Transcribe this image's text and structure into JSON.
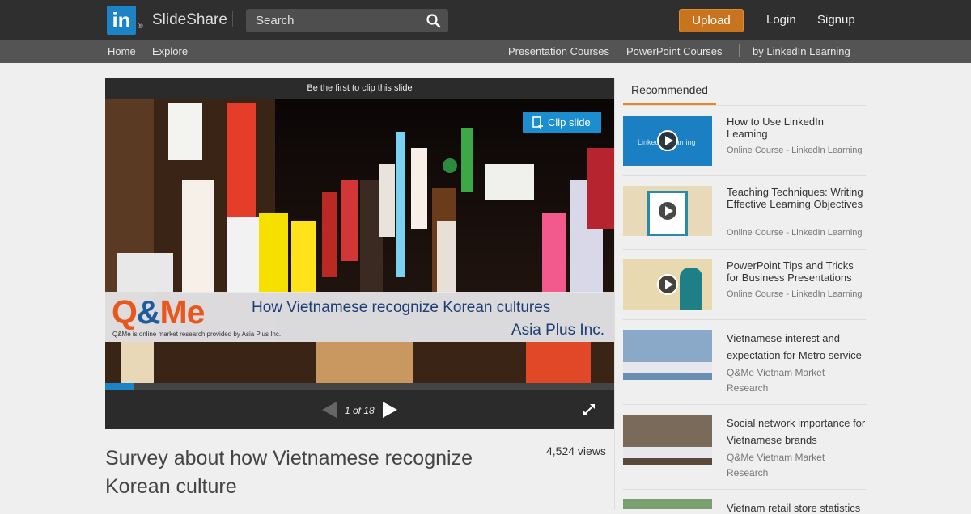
{
  "header": {
    "logo_text": "in",
    "logo_reg": "®",
    "brand": "SlideShare",
    "search_placeholder": "Search",
    "upload_label": "Upload",
    "login_label": "Login",
    "signup_label": "Signup"
  },
  "subnav": {
    "home": "Home",
    "explore": "Explore",
    "presentation_courses": "Presentation Courses",
    "powerpoint_courses": "PowerPoint Courses",
    "by_linkedin": "by LinkedIn Learning"
  },
  "player": {
    "clip_hint": "Be the first to clip this slide",
    "clip_button": "Clip slide",
    "page_indicator": "1 of 18",
    "progress": 0.055,
    "slide": {
      "logo_q": "Q",
      "logo_amp": "&",
      "logo_me": "Me",
      "logo_sub": "Q&Me is online market research provided by Asia Plus Inc.",
      "title": "How Vietnamese recognize Korean cultures",
      "company": "Asia Plus Inc."
    }
  },
  "document": {
    "title": "Survey about how Vietnamese recognize Korean culture",
    "views": "4,524 views"
  },
  "recommended": {
    "tab_label": "Recommended",
    "items": [
      {
        "title": "How to Use LinkedIn Learning",
        "meta": "Online Course - LinkedIn Learning",
        "thumb_text": "LinkedIn Learning"
      },
      {
        "title": "Teaching Techniques: Writing Effective Learning Objectives",
        "meta": "Online Course - LinkedIn Learning"
      },
      {
        "title": "PowerPoint Tips and Tricks for Business Presentations",
        "meta": "Online Course - LinkedIn Learning"
      },
      {
        "title": "Vietnamese interest and expectation for Metro service",
        "meta": "Q&Me Vietnam Market Research"
      },
      {
        "title": "Social network importance for Vietnamese brands",
        "meta": "Q&Me Vietnam Market Research"
      },
      {
        "title": "Vietnam retail store statistics",
        "meta": ""
      }
    ]
  },
  "colors": {
    "linkedin_blue": "#1c84c6",
    "upload_orange": "#c8731d",
    "tab_accent": "#e8822b"
  }
}
